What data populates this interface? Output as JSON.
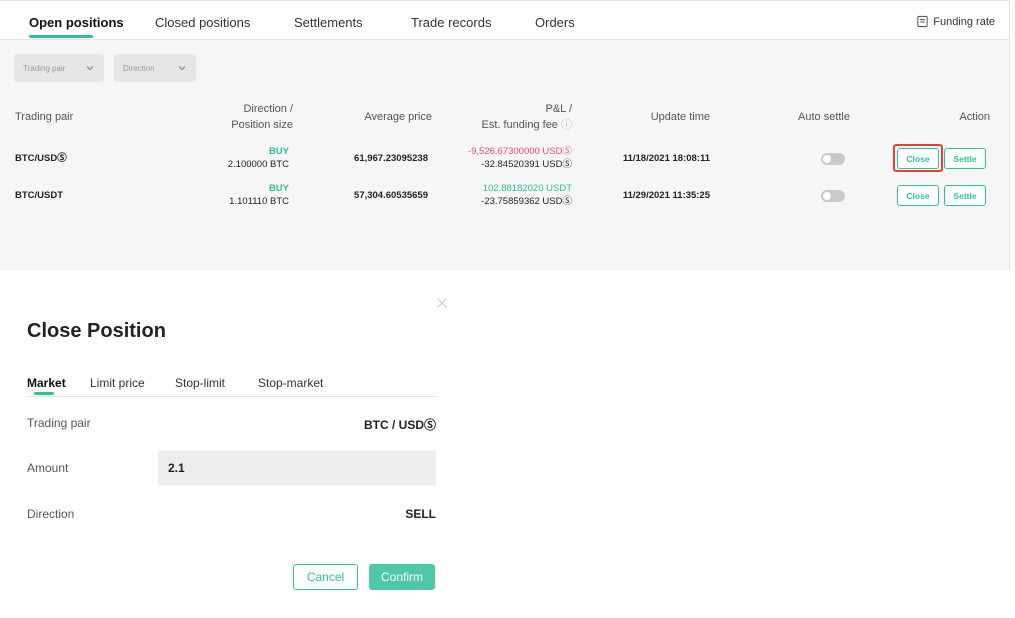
{
  "tabs": [
    {
      "label": "Open positions"
    },
    {
      "label": "Closed positions"
    },
    {
      "label": "Settlements"
    },
    {
      "label": "Trade records"
    },
    {
      "label": "Orders"
    }
  ],
  "funding_rate_label": "Funding rate",
  "filters": {
    "trading_pair": "Trading pair",
    "direction": "Direction"
  },
  "table": {
    "headers": {
      "trading_pair": "Trading pair",
      "direction_line1": "Direction /",
      "direction_line2": "Position size",
      "average_price": "Average price",
      "pnl_line1": "P&L /",
      "pnl_line2": "Est. funding fee",
      "update_time": "Update time",
      "auto_settle": "Auto settle",
      "action": "Action"
    },
    "rows": [
      {
        "pair": "BTC/USDⓈ",
        "direction": "BUY",
        "size": "2.100000 BTC",
        "avg_price": "61,967.23095238",
        "pnl": "-9,526.67300000 USDⓈ",
        "funding_fee": "-32.84520391 USDⓈ",
        "update_time": "11/18/2021 18:08:11",
        "close_label": "Close",
        "settle_label": "Settle"
      },
      {
        "pair": "BTC/USDT",
        "direction": "BUY",
        "size": "1.101110 BTC",
        "avg_price": "57,304.60535659",
        "pnl": "102.88182020 USDT",
        "funding_fee": "-23.75859362 USDⓈ",
        "update_time": "11/29/2021 11:35:25",
        "close_label": "Close",
        "settle_label": "Settle"
      }
    ]
  },
  "modal": {
    "title": "Close Position",
    "tabs": [
      {
        "label": "Market"
      },
      {
        "label": "Limit price"
      },
      {
        "label": "Stop-limit"
      },
      {
        "label": "Stop-market"
      }
    ],
    "trading_pair_label": "Trading pair",
    "trading_pair_value": "BTC / USDⓈ",
    "amount_label": "Amount",
    "amount_value": "2.1",
    "direction_label": "Direction",
    "direction_value": "SELL",
    "cancel_label": "Cancel",
    "confirm_label": "Confirm"
  },
  "colors": {
    "accent": "#2ec09c",
    "loss": "#e84b6a",
    "highlight": "#e0423a"
  }
}
